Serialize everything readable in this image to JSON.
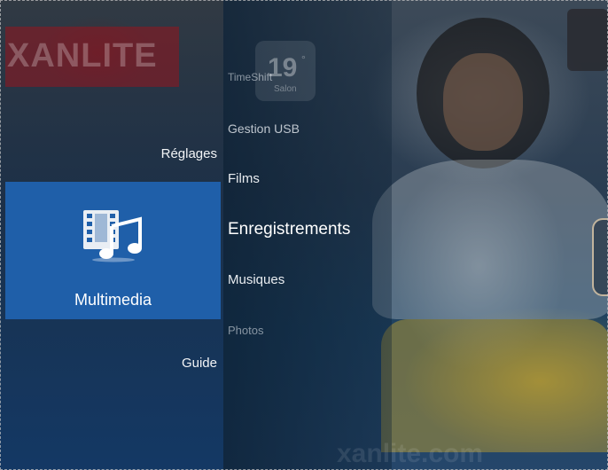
{
  "brand": {
    "logo_text": "XANLITE"
  },
  "widget": {
    "value": "19",
    "unit": "°",
    "label": "Salon"
  },
  "main_menu": {
    "items": [
      {
        "label": "Réglages",
        "icon": "settings-icon"
      },
      {
        "label": "Multimedia",
        "icon": "film-music-icon",
        "selected": true
      },
      {
        "label": "Guide",
        "icon": "guide-icon"
      }
    ]
  },
  "submenu": {
    "items": [
      {
        "label": "TimeShift"
      },
      {
        "label": "Gestion USB"
      },
      {
        "label": "Films"
      },
      {
        "label": "Enregistrements",
        "highlighted": true
      },
      {
        "label": "Musiques"
      },
      {
        "label": "Photos"
      }
    ]
  },
  "footer": {
    "watermark": "xanlite.com"
  },
  "colors": {
    "selected_tile": "#1f5fa9",
    "brand_red": "#96141e",
    "couch_yellow": "#c8a52d"
  }
}
